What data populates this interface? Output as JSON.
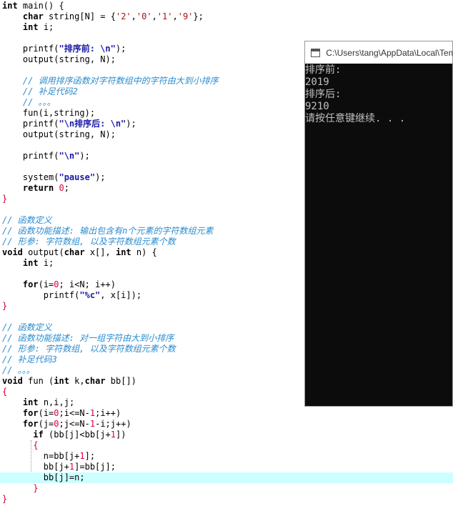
{
  "code_lines": [
    {
      "segments": [
        {
          "t": "int",
          "c": "kw"
        },
        {
          "t": " main() {"
        }
      ]
    },
    {
      "segments": [
        {
          "t": "    "
        },
        {
          "t": "char",
          "c": "kw"
        },
        {
          "t": " string[N] = {"
        },
        {
          "t": "'2'",
          "c": "str"
        },
        {
          "t": ","
        },
        {
          "t": "'0'",
          "c": "str"
        },
        {
          "t": ","
        },
        {
          "t": "'1'",
          "c": "str"
        },
        {
          "t": ","
        },
        {
          "t": "'9'",
          "c": "str"
        },
        {
          "t": "};"
        }
      ]
    },
    {
      "segments": [
        {
          "t": "    "
        },
        {
          "t": "int",
          "c": "kw"
        },
        {
          "t": " i;"
        }
      ]
    },
    {
      "segments": []
    },
    {
      "segments": [
        {
          "t": "    printf("
        },
        {
          "t": "\"排序前: \\n\"",
          "c": "strb"
        },
        {
          "t": ");"
        }
      ]
    },
    {
      "segments": [
        {
          "t": "    output(string, N);"
        }
      ]
    },
    {
      "segments": []
    },
    {
      "segments": [
        {
          "t": "    "
        },
        {
          "t": "// 调用排序函数对字符数组中的字符由大到小排序",
          "c": "cm"
        }
      ]
    },
    {
      "segments": [
        {
          "t": "    "
        },
        {
          "t": "// 补足代码2",
          "c": "cm"
        }
      ]
    },
    {
      "segments": [
        {
          "t": "    "
        },
        {
          "t": "// 。。。",
          "c": "cm"
        }
      ]
    },
    {
      "segments": [
        {
          "t": "    fun(i,string);"
        }
      ]
    },
    {
      "segments": [
        {
          "t": "    printf("
        },
        {
          "t": "\"\\n排序后: \\n\"",
          "c": "strb"
        },
        {
          "t": ");"
        }
      ]
    },
    {
      "segments": [
        {
          "t": "    output(string, N);"
        }
      ]
    },
    {
      "segments": []
    },
    {
      "segments": [
        {
          "t": "    printf("
        },
        {
          "t": "\"\\n\"",
          "c": "strb"
        },
        {
          "t": ");"
        }
      ]
    },
    {
      "segments": []
    },
    {
      "segments": [
        {
          "t": "    system("
        },
        {
          "t": "\"pause\"",
          "c": "strb"
        },
        {
          "t": ");"
        }
      ]
    },
    {
      "segments": [
        {
          "t": "    "
        },
        {
          "t": "return",
          "c": "kw"
        },
        {
          "t": " "
        },
        {
          "t": "0",
          "c": "num"
        },
        {
          "t": ";"
        }
      ]
    },
    {
      "segments": [
        {
          "t": "}",
          "c": "op"
        }
      ]
    },
    {
      "segments": []
    },
    {
      "segments": [
        {
          "t": "// 函数定义",
          "c": "cm"
        }
      ]
    },
    {
      "segments": [
        {
          "t": "// 函数功能描述: 输出包含有n个元素的字符数组元素",
          "c": "cm"
        }
      ]
    },
    {
      "segments": [
        {
          "t": "// 形参: 字符数组, 以及字符数组元素个数",
          "c": "cm"
        }
      ]
    },
    {
      "segments": [
        {
          "t": "void",
          "c": "kw"
        },
        {
          "t": " output("
        },
        {
          "t": "char",
          "c": "kw"
        },
        {
          "t": " x[], "
        },
        {
          "t": "int",
          "c": "kw"
        },
        {
          "t": " n) {"
        }
      ]
    },
    {
      "segments": [
        {
          "t": "    "
        },
        {
          "t": "int",
          "c": "kw"
        },
        {
          "t": " i;"
        }
      ]
    },
    {
      "segments": []
    },
    {
      "segments": [
        {
          "t": "    "
        },
        {
          "t": "for",
          "c": "kw"
        },
        {
          "t": "(i="
        },
        {
          "t": "0",
          "c": "num"
        },
        {
          "t": "; i<N; i++)"
        }
      ]
    },
    {
      "segments": [
        {
          "t": "        printf("
        },
        {
          "t": "\"%c\"",
          "c": "strb"
        },
        {
          "t": ", x[i]);"
        }
      ]
    },
    {
      "segments": [
        {
          "t": "}",
          "c": "op"
        }
      ]
    },
    {
      "segments": []
    },
    {
      "segments": [
        {
          "t": "// 函数定义",
          "c": "cm"
        }
      ]
    },
    {
      "segments": [
        {
          "t": "// 函数功能描述: 对一组字符由大到小排序",
          "c": "cm"
        }
      ]
    },
    {
      "segments": [
        {
          "t": "// 形参: 字符数组, 以及字符数组元素个数",
          "c": "cm"
        }
      ]
    },
    {
      "segments": [
        {
          "t": "// 补足代码3",
          "c": "cm"
        }
      ]
    },
    {
      "segments": [
        {
          "t": "// 。。。",
          "c": "cm"
        }
      ]
    },
    {
      "segments": [
        {
          "t": "void",
          "c": "kw"
        },
        {
          "t": " fun ("
        },
        {
          "t": "int",
          "c": "kw"
        },
        {
          "t": " k,"
        },
        {
          "t": "char",
          "c": "kw"
        },
        {
          "t": " bb[])"
        }
      ]
    },
    {
      "segments": [
        {
          "t": "{",
          "c": "op"
        }
      ]
    },
    {
      "segments": [
        {
          "t": "    "
        },
        {
          "t": "int",
          "c": "kw"
        },
        {
          "t": " n,i,j;"
        }
      ]
    },
    {
      "segments": [
        {
          "t": "    "
        },
        {
          "t": "for",
          "c": "kw"
        },
        {
          "t": "(i="
        },
        {
          "t": "0",
          "c": "num"
        },
        {
          "t": ";i<=N-"
        },
        {
          "t": "1",
          "c": "num"
        },
        {
          "t": ";i++)"
        }
      ]
    },
    {
      "segments": [
        {
          "t": "    "
        },
        {
          "t": "for",
          "c": "kw"
        },
        {
          "t": "(j="
        },
        {
          "t": "0",
          "c": "num"
        },
        {
          "t": ";j<=N-"
        },
        {
          "t": "1",
          "c": "num"
        },
        {
          "t": "-i;j++)"
        }
      ]
    },
    {
      "segments": [
        {
          "t": "      "
        },
        {
          "t": "if",
          "c": "kw"
        },
        {
          "t": " (bb[j]<bb[j+"
        },
        {
          "t": "1",
          "c": "num"
        },
        {
          "t": "])"
        }
      ]
    },
    {
      "segments": [
        {
          "t": "      "
        },
        {
          "t": "{",
          "c": "op"
        }
      ]
    },
    {
      "segments": [
        {
          "t": "        n=bb[j+"
        },
        {
          "t": "1",
          "c": "num"
        },
        {
          "t": "];"
        }
      ]
    },
    {
      "segments": [
        {
          "t": "        bb[j+"
        },
        {
          "t": "1",
          "c": "num"
        },
        {
          "t": "]=bb[j];"
        }
      ]
    },
    {
      "segments": [
        {
          "t": "        bb[j]=n;"
        }
      ],
      "highlight": true
    },
    {
      "segments": [
        {
          "t": "      "
        },
        {
          "t": "}",
          "c": "op"
        }
      ]
    },
    {
      "segments": [
        {
          "t": "}",
          "c": "op"
        }
      ]
    }
  ],
  "console": {
    "title": "C:\\Users\\tang\\AppData\\Local\\Temp",
    "output_lines": [
      "排序前:",
      "2019",
      "排序后:",
      "9210",
      "请按任意键继续. . ."
    ]
  },
  "colors": {
    "keyword": "#000000",
    "char_literal": "#a31515",
    "string_literal": "#1a1aa6",
    "number": "#e0003c",
    "comment": "#2b8ccf",
    "current_line": "#ccffff",
    "console_bg": "#0c0c0c",
    "console_text": "#c0c0c0"
  },
  "icons": {
    "console_app": "console-window-icon"
  }
}
